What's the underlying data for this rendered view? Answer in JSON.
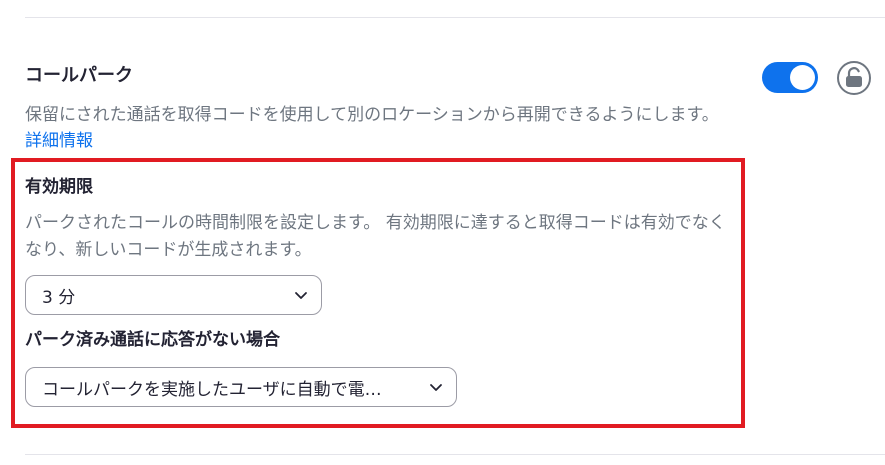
{
  "setting": {
    "title": "コールパーク",
    "description": "保留にされた通話を取得コードを使用して別のロケーションから再開できるようにします。",
    "link": "詳細情報",
    "enabled": true,
    "accent_color": "#0e72ed"
  },
  "highlight_color": "#e11b22",
  "expiration": {
    "label": "有効期限",
    "description": "パークされたコールの時間制限を設定します。 有効期限に達すると取得コードは有効でなくなり、新しいコードが生成されます。",
    "selected": "3 分"
  },
  "unanswered": {
    "label": "パーク済み通話に応答がない場合",
    "selected": "コールパークを実施したユーザに自動で電…"
  },
  "icons": {
    "lock": "unlock-icon",
    "chevron": "chevron-down-icon"
  }
}
